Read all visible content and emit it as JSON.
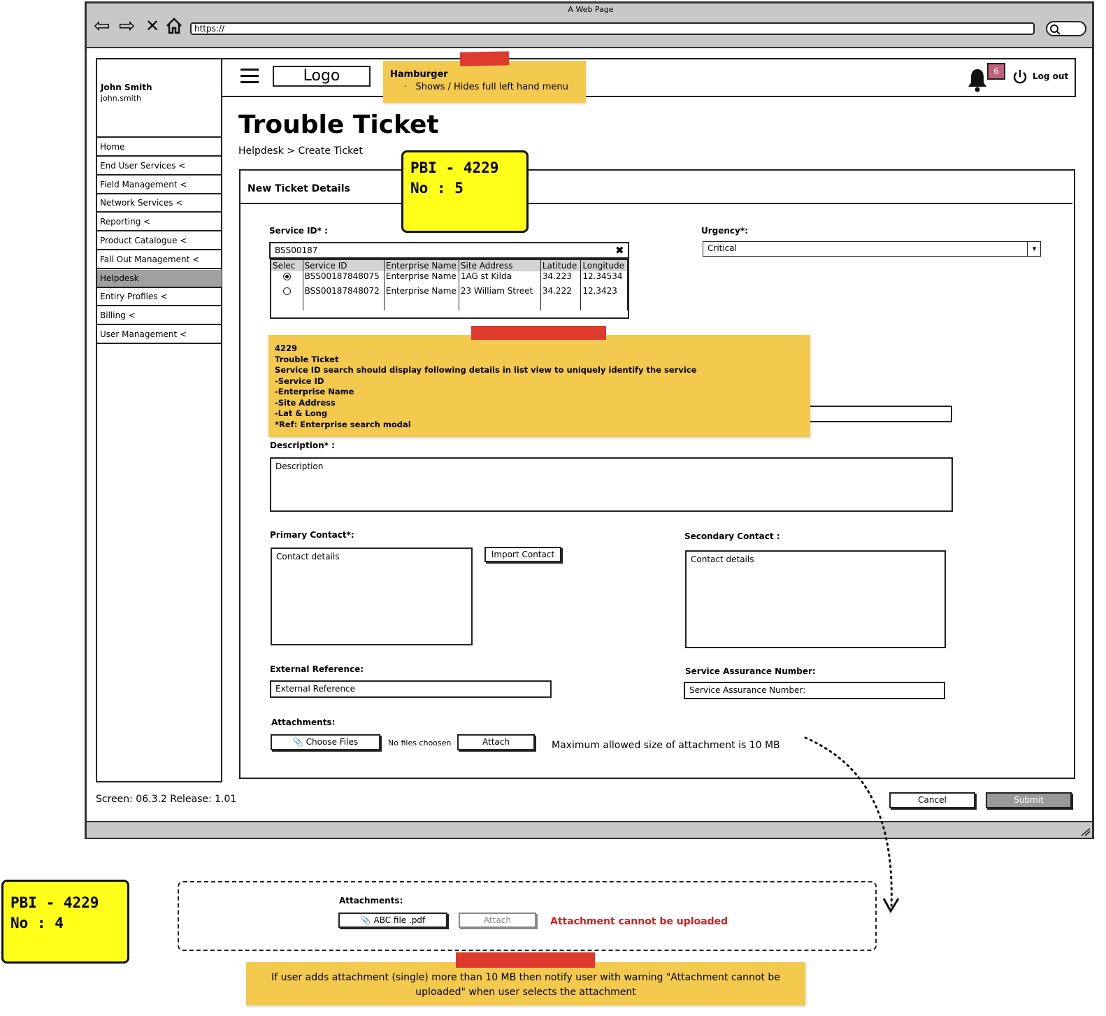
{
  "window": {
    "title": "A Web Page",
    "url": "https://"
  },
  "user": {
    "name": "John Smith",
    "login": "john.smith"
  },
  "sidebar": {
    "items": [
      {
        "label": "Home"
      },
      {
        "label": "End User Services <"
      },
      {
        "label": "Field Management <"
      },
      {
        "label": "Network Services <"
      },
      {
        "label": "Reporting <"
      },
      {
        "label": "Product Catalogue <"
      },
      {
        "label": "Fall Out Management <"
      },
      {
        "label": "Helpdesk",
        "active": true
      },
      {
        "label": "Entiry Profiles <"
      },
      {
        "label": "Billing <"
      },
      {
        "label": "User Management <"
      }
    ]
  },
  "header": {
    "logo": "Logo",
    "notification_count": "6",
    "logout": "Log out"
  },
  "hamburger_note": {
    "title": "Hamburger",
    "text": "·   Shows / Hides full left hand menu"
  },
  "page": {
    "title": "Trouble Ticket",
    "breadcrumb": "Helpdesk > Create Ticket",
    "panel_title": "New Ticket Details"
  },
  "pbi_top": {
    "line1": "PBI - 4229",
    "line2": "No : 5"
  },
  "pbi_bottom": {
    "line1": "PBI - 4229",
    "line2": "No : 4"
  },
  "form": {
    "service_id_label": "Service ID* :",
    "service_id_value": "BSS00187",
    "results": {
      "headers": [
        "Selec",
        "Service ID",
        "Enterprise Name",
        "Site Address",
        "Latitude",
        "Longitude"
      ],
      "rows": [
        {
          "selected": true,
          "cells": [
            "BSS00187848075",
            "Enterprise Name",
            "1AG st Kilda",
            "34.223",
            "12.34534"
          ]
        },
        {
          "selected": false,
          "cells": [
            "BSS00187848072",
            "Enterprise Name",
            "23 William Street",
            "34.222",
            "12.3423"
          ]
        }
      ]
    },
    "urgency_label": "Urgency*:",
    "urgency_value": "Critical",
    "description_label": "Description* :",
    "description_placeholder": "Description",
    "primary_contact_label": "Primary Contact*:",
    "primary_contact_placeholder": "Contact details",
    "import_contact": "Import Contact",
    "secondary_contact_label": "Secondary  Contact :",
    "secondary_contact_placeholder": "Contact details",
    "external_ref_label": "External Reference:",
    "external_ref_placeholder": "External Reference",
    "san_label": "Service Assurance Number:",
    "san_placeholder": "Service Assurance Number:",
    "attachments_label": "Attachments:",
    "choose_files": "Choose Files",
    "no_files": "No files choosen",
    "attach": "Attach",
    "max_size_note": "Maximum allowed size of attachment is 10 MB"
  },
  "service_note": {
    "lines": [
      "4229",
      "Trouble Ticket",
      "Service ID search should display following details in list view to uniquely identify the service",
      "-Service ID",
      "-Enterprise Name",
      "-Site Address",
      "-Lat & Long",
      "*Ref: Enterprise search modal"
    ]
  },
  "footer": {
    "screen_info": "Screen: 06.3.2 Release: 1.01",
    "cancel": "Cancel",
    "submit": "Submit"
  },
  "error_example": {
    "attachments_label": "Attachments:",
    "file_name": "ABC file .pdf",
    "attach": "Attach",
    "error": "Attachment cannot be uploaded"
  },
  "bottom_note": "If user adds attachment (single) more than 10 MB then notify user with warning \"Attachment cannot be uploaded\" when user selects the attachment",
  "colors": {
    "sticky": "#f3c94e",
    "tape": "#de3a2e",
    "pbi": "#ffff1a",
    "error": "#cc2222",
    "badge": "#c0607a"
  }
}
